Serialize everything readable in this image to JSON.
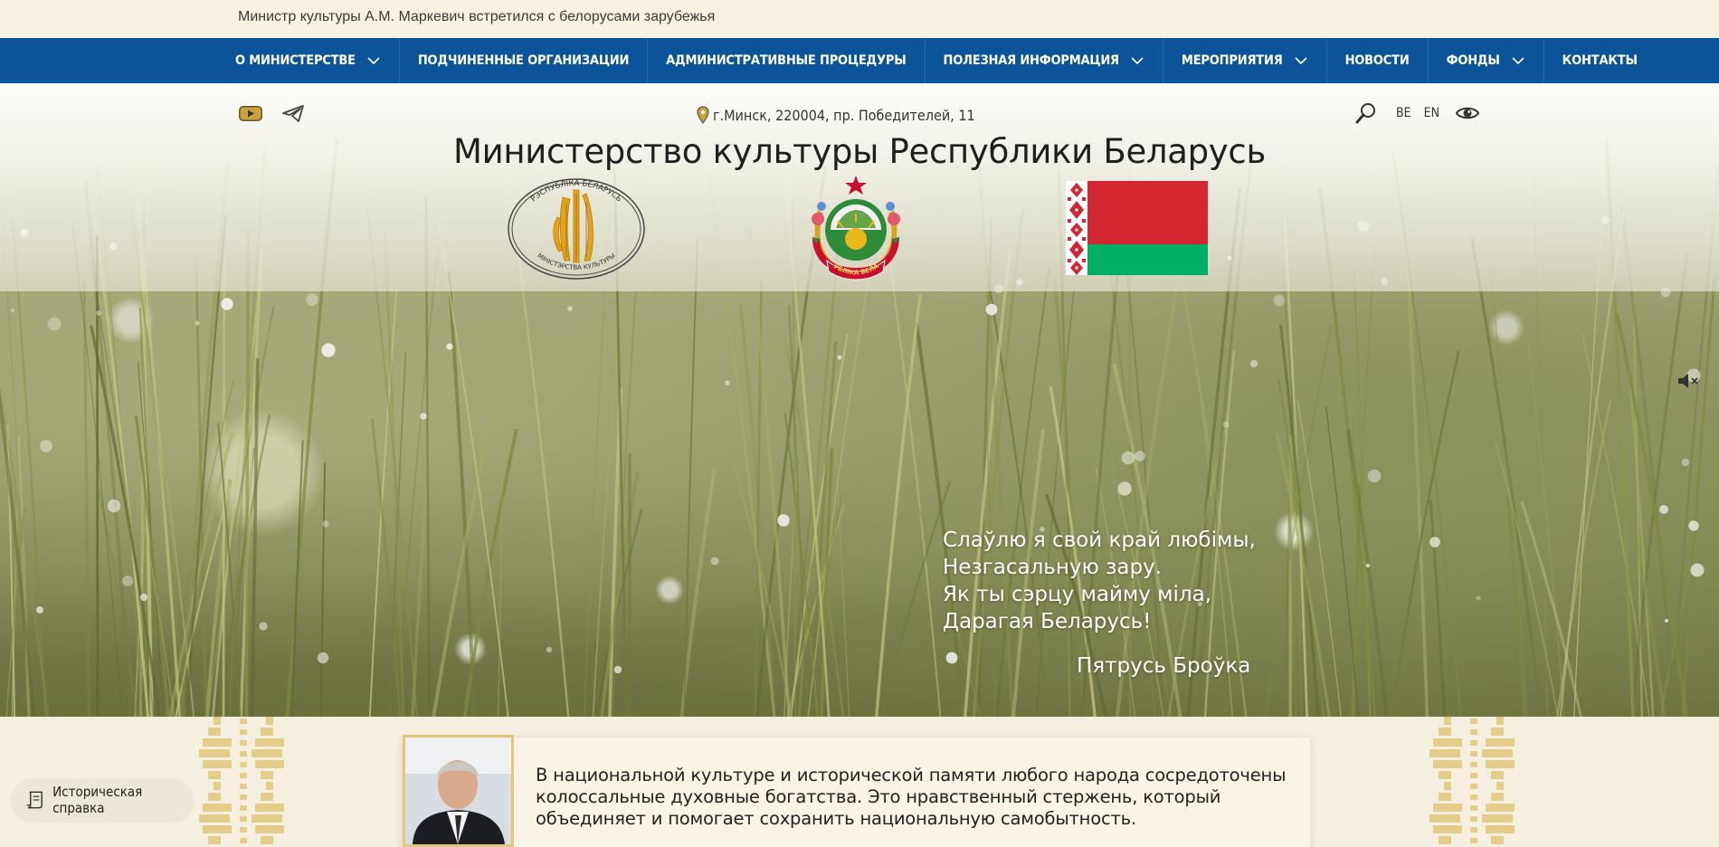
{
  "ticker": {
    "text": "Министр культуры А.М. Маркевич встретился с белорусами зарубежья"
  },
  "nav": {
    "items": [
      {
        "label": "О МИНИСТЕРСТВЕ",
        "has_dropdown": true
      },
      {
        "label": "ПОДЧИНЕННЫЕ ОРГАНИЗАЦИИ",
        "has_dropdown": false
      },
      {
        "label": "АДМИНИСТРАТИВНЫЕ ПРОЦЕДУРЫ",
        "has_dropdown": false
      },
      {
        "label": "ПОЛЕЗНАЯ ИНФОРМАЦИЯ",
        "has_dropdown": true
      },
      {
        "label": "МЕРОПРИЯТИЯ",
        "has_dropdown": true
      },
      {
        "label": "НОВОСТИ",
        "has_dropdown": false
      },
      {
        "label": "ФОНДЫ",
        "has_dropdown": true
      },
      {
        "label": "КОНТАКТЫ",
        "has_dropdown": false
      }
    ],
    "background": "#0b5499"
  },
  "header": {
    "social": [
      "youtube-icon",
      "telegram-icon"
    ],
    "address": "г.Минск, 220004, пр. Победителей, 11",
    "title": "Министерство культуры Республики Беларусь",
    "languages": [
      "BE",
      "EN"
    ],
    "tools": [
      "search-icon",
      "accessibility-eye-icon"
    ],
    "emblem_text_top": "РЭСПУБЛІКА БЕЛАРУСЬ",
    "emblem_text_bottom": "МІНІСТЭРСТВА КУЛЬТУРЫ",
    "coat_of_arms_ribbon": "РЭСПУБЛІКА БЕЛАРУСЬ",
    "flag_colors": {
      "red": "#d22730",
      "green": "#00af66"
    }
  },
  "hero": {
    "poem_lines": [
      "Слаўлю я свой край любімы,",
      "Незгасальную зару.",
      "Як ты сэрцу майму міла,",
      "Дарагая Беларусь!"
    ],
    "poem_author": "Пятрусь Броўка",
    "mute_icon": "speaker-muted-icon"
  },
  "intro": {
    "quote": "В национальной культуре и исторической памяти любого народа сосредоточены колоссальные духовные богатства. Это нравственный стержень, который объединяет и помогает сохранить национальную самобытность."
  },
  "history_button": {
    "label": "Историческая справка"
  },
  "accent_gold": "#e0c77a"
}
